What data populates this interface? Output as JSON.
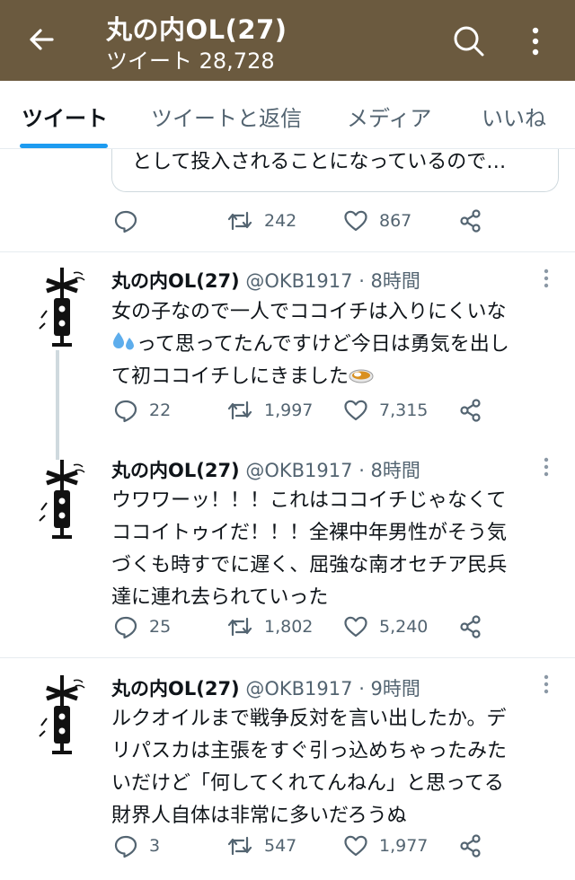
{
  "header": {
    "title": "丸の内OL(27)",
    "subtitle": "ツイート 28,728",
    "bg_color": "#6b5a3f"
  },
  "tabs": [
    {
      "label": "ツイート",
      "active": true
    },
    {
      "label": "ツイートと返信",
      "active": false
    },
    {
      "label": "メディア",
      "active": false
    },
    {
      "label": "いいね",
      "active": false
    }
  ],
  "quoted": {
    "text": "として投入されることになっているので…",
    "retweets": "242",
    "likes": "867"
  },
  "tweets": [
    {
      "name": "丸の内OL(27)",
      "handle": "@OKB1917",
      "time": "· 8時間",
      "line1": "女の子なので一人でココイチは入りにくいな",
      "line2": "って思ってたんですけど今日は勇気を出し",
      "line3": "て初ココイチしにきました",
      "replies": "22",
      "retweets": "1,997",
      "likes": "7,315"
    },
    {
      "name": "丸の内OL(27)",
      "handle": "@OKB1917",
      "time": "· 8時間",
      "line1": "ウワワーッ！！！これはココイチじゃなくて",
      "line2": "ココイトゥイだ！！！全裸中年男性がそう気",
      "line3": "づくも時すでに遅く、屈強な南オセチア民兵",
      "line4": "達に連れ去られていった",
      "replies": "25",
      "retweets": "1,802",
      "likes": "5,240"
    },
    {
      "name": "丸の内OL(27)",
      "handle": "@OKB1917",
      "time": "· 9時間",
      "line1": "ルクオイルまで戦争反対を言い出したか。デ",
      "line2": "リパスカは主張をすぐ引っ込めちゃったみた",
      "line3": "いだけど「何してくれてんねん」と思ってる",
      "line4": "財界人自体は非常に多いだろうぬ",
      "replies": "3",
      "retweets": "547",
      "likes": "1,977"
    }
  ],
  "colors": {
    "accent": "#1d9bf0",
    "muted": "#536471"
  }
}
